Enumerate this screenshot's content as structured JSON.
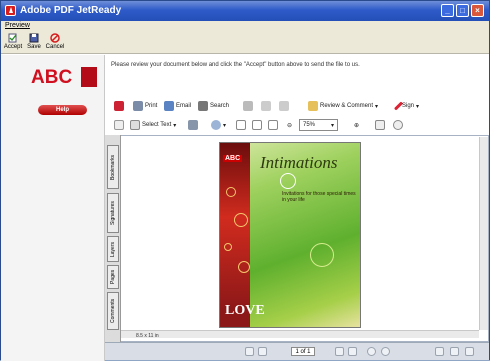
{
  "window": {
    "title": "Adobe PDF JetReady"
  },
  "menubar": {
    "items": [
      {
        "label": "Preview"
      }
    ]
  },
  "commands": [
    {
      "label": "Accept",
      "icon": "accept-icon"
    },
    {
      "label": "Save",
      "icon": "save-icon"
    },
    {
      "label": "Cancel",
      "icon": "cancel-icon"
    }
  ],
  "sidebar": {
    "logo_text": "ABC",
    "help_label": "Help"
  },
  "main": {
    "instruction": "Please review your document below and click the \"Accept\" button above to send the file to us."
  },
  "toolbar1": {
    "print_label": "Print",
    "email_label": "Email",
    "search_label": "Search",
    "review_label": "Review & Comment",
    "sign_label": "Sign"
  },
  "toolbar2": {
    "select_text_label": "Select Text",
    "zoom_value": "75%"
  },
  "nav_tabs": [
    {
      "label": "Bookmarks"
    },
    {
      "label": "Signatures"
    },
    {
      "label": "Layers"
    },
    {
      "label": "Pages"
    },
    {
      "label": "Comments"
    }
  ],
  "document": {
    "title": "Intimations",
    "subtitle": "Invitations for those special times in your life",
    "logo_text": "ABC",
    "corner_text": "LOVE",
    "page_size": "8.5 x 11 in"
  },
  "status": {
    "page_indicator": "1 of 1"
  },
  "colors": {
    "titlebar": "#2e5bc9",
    "accent_red": "#d00f1f",
    "help_button": "#c21414"
  }
}
